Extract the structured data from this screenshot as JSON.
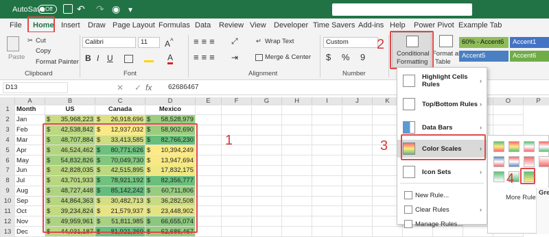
{
  "titlebar": {
    "autosave": "AutoSave",
    "toggle": "Off"
  },
  "menu": [
    "File",
    "Home",
    "Insert",
    "Draw",
    "Page Layout",
    "Formulas",
    "Data",
    "Review",
    "View",
    "Developer",
    "Time Savers",
    "Add-ins",
    "Help",
    "Power Pivot",
    "Example Tab"
  ],
  "ribbon": {
    "paste": "Paste",
    "cut": "Cut",
    "copy": "Copy",
    "format_painter": "Format Painter",
    "clipboard": "Clipboard",
    "font_name": "Calibri",
    "font_size": "11",
    "font_group": "Font",
    "wrap_text": "Wrap Text",
    "merge_center": "Merge & Center",
    "alignment": "Alignment",
    "number_format": "Custom",
    "number_group": "Number",
    "symbols": "$ % 9",
    "cond_fmt_line1": "Conditional",
    "cond_fmt_line2": "Formatting",
    "fmt_table_line1": "Format as",
    "fmt_table_line2": "Table",
    "styles": [
      "60% - Accent6",
      "Accent1",
      "Accent5",
      "Accent6"
    ]
  },
  "formula": {
    "cell_ref": "D13",
    "value": "62686467"
  },
  "columns": [
    "A",
    "B",
    "C",
    "D",
    "E",
    "F",
    "G",
    "H",
    "I",
    "J",
    "K",
    "L",
    "M",
    "N",
    "O",
    "P"
  ],
  "table": {
    "header": [
      "Month",
      "US",
      "Canada",
      "Mexico"
    ],
    "rows": [
      [
        "Jan",
        "35,968,223",
        "26,918,696",
        "58,528,979"
      ],
      [
        "Feb",
        "42,538,842",
        "12,937,032",
        "58,902,690"
      ],
      [
        "Mar",
        "48,707,884",
        "33,413,585",
        "82,766,230"
      ],
      [
        "Apr",
        "46,524,462",
        "80,771,626",
        "10,394,249"
      ],
      [
        "May",
        "54,832,826",
        "70,049,730",
        "13,947,694"
      ],
      [
        "Jun",
        "42,828,035",
        "42,515,895",
        "17,832,175"
      ],
      [
        "Jul",
        "43,701,933",
        "78,921,192",
        "82,356,777"
      ],
      [
        "Aug",
        "48,727,448",
        "85,142,242",
        "60,711,806"
      ],
      [
        "Sep",
        "44,864,363",
        "30,482,713",
        "36,282,508"
      ],
      [
        "Oct",
        "39,234,824",
        "21,579,937",
        "23,448,902"
      ],
      [
        "Nov",
        "49,959,961",
        "51,811,985",
        "66,655,074"
      ],
      [
        "Dec",
        "44,031,187",
        "81,921,369",
        "62,686,467"
      ]
    ],
    "currency": "$"
  },
  "dropdown": [
    "Highlight Cells Rules",
    "Top/Bottom Rules",
    "Data Bars",
    "Color Scales",
    "Icon Sets",
    "New Rule...",
    "Clear Rules",
    "Manage Rules..."
  ],
  "submenu": {
    "more_rules": "More Rules",
    "tooltip_title": "Gree"
  },
  "callouts": [
    "1",
    "2",
    "3",
    "4"
  ],
  "colors": {
    "green": "#63be7b",
    "yellow": "#ffeb84",
    "red_callout": "#e04848",
    "excel_green": "#217346"
  }
}
